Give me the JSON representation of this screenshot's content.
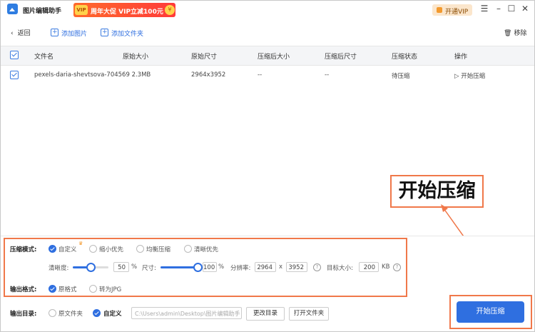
{
  "app": {
    "title": "图片编辑助手"
  },
  "promo": {
    "chip": "VIP",
    "text": "周年大促 VIP立减100元",
    "coin": "¥"
  },
  "titlebar": {
    "vip_button": "开通VIP"
  },
  "toolbar": {
    "back": "返回",
    "add_image": "添加图片",
    "add_folder": "添加文件夹",
    "remove": "移除"
  },
  "table": {
    "headers": [
      "文件名",
      "原始大小",
      "原始尺寸",
      "压缩后大小",
      "压缩后尺寸",
      "压缩状态",
      "操作"
    ],
    "rows": [
      {
        "name": "pexels-daria-shevtsova-704569",
        "size": "2.3MB",
        "dims": "2964x3952",
        "out_size": "--",
        "out_dims": "--",
        "status": "待压缩",
        "action": "开始压缩"
      }
    ]
  },
  "settings": {
    "mode_label": "压缩模式:",
    "modes": [
      "自定义",
      "缩小优先",
      "均衡压缩",
      "清晰优先"
    ],
    "selected_mode": "自定义",
    "clarity_label": "清晰度:",
    "clarity_value": "50",
    "clarity_unit": "%",
    "clarity_fraction": 0.5,
    "size_label": "尺寸:",
    "size_value": "100",
    "size_unit": "%",
    "size_fraction": 1.0,
    "resolution_label": "分辨率:",
    "res_w": "2964",
    "res_x": "x",
    "res_h": "3952",
    "target_label": "目标大小:",
    "target_value": "200",
    "target_unit": "KB",
    "format_label": "输出格式:",
    "formats": [
      "原格式",
      "转为JPG"
    ],
    "output_label": "输出目录:",
    "output_options": [
      "原文件夹",
      "自定义"
    ],
    "output_path": "C:\\Users\\admin\\Desktop\\图片编辑助手",
    "change_dir": "更改目录",
    "open_folder": "打开文件夹"
  },
  "start_button": "开始压缩",
  "callout": "开始压缩"
}
